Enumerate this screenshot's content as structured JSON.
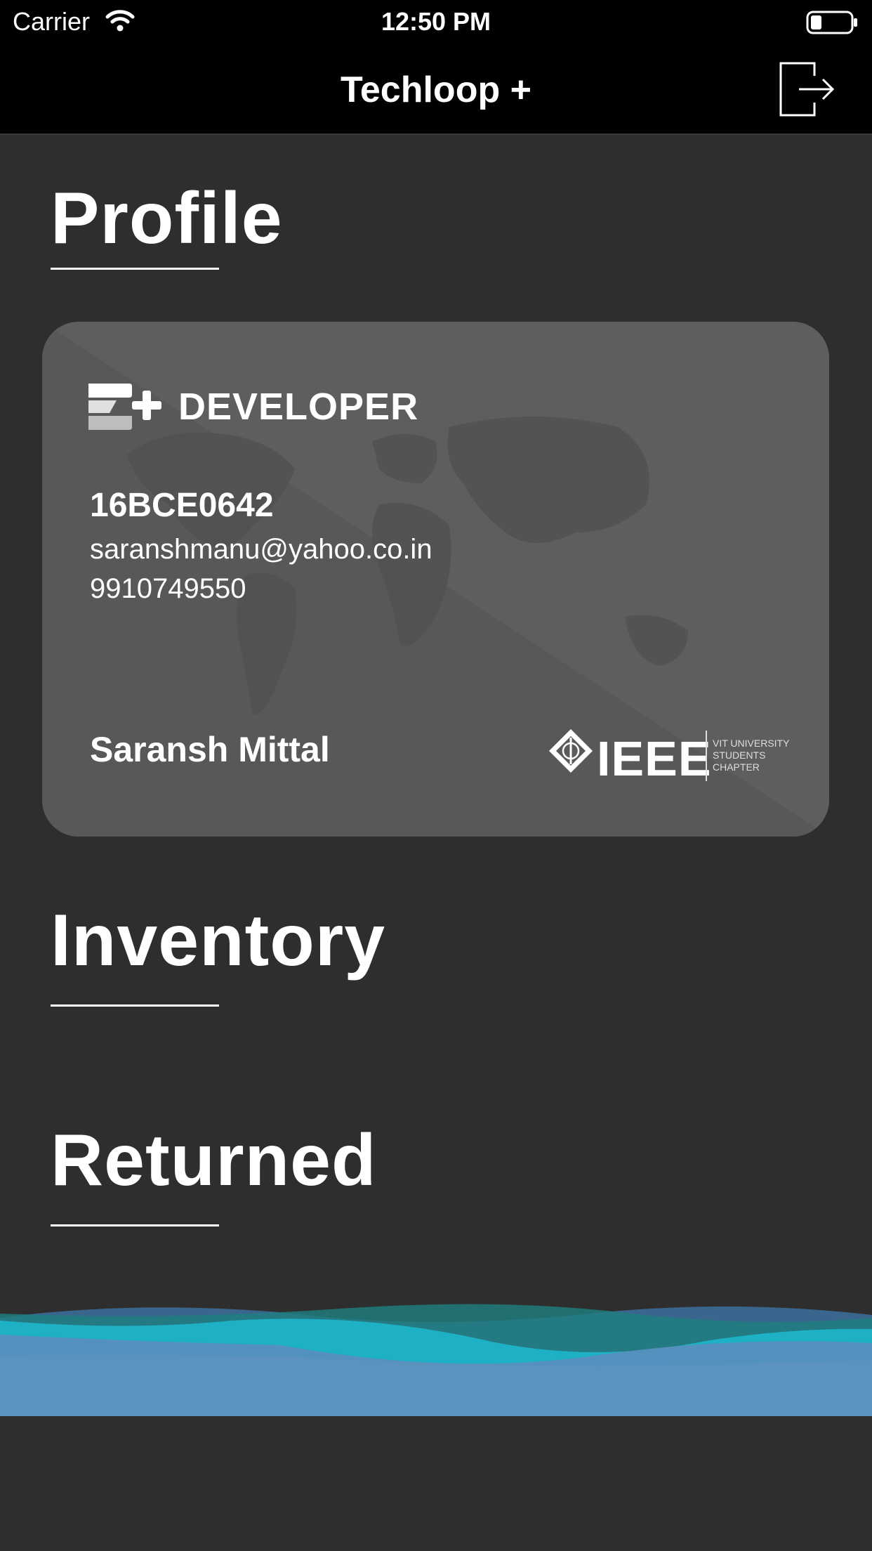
{
  "status_bar": {
    "carrier": "Carrier",
    "time": "12:50 PM"
  },
  "nav": {
    "title": "Techloop +"
  },
  "sections": {
    "profile": "Profile",
    "inventory": "Inventory",
    "returned": "Returned"
  },
  "card": {
    "role": "DEVELOPER",
    "reg_no": "16BCE0642",
    "email": "saranshmanu@yahoo.co.in",
    "phone": "9910749550",
    "name": "Saransh Mittal",
    "org_logo_text": "IEEE",
    "org_chapter": [
      "VIT UNIVERSITY",
      "STUDENTS",
      "CHAPTER"
    ]
  },
  "icons": [
    "wifi-icon",
    "battery-icon",
    "logout-icon",
    "developer-badge-icon",
    "ieee-logo-icon",
    "world-map-graphic",
    "wave-graphic"
  ],
  "colors": {
    "background": "#2e2e2e",
    "card": "#555555",
    "wave_teal": "#1fb5c5",
    "wave_blue": "#5a8bbd"
  }
}
